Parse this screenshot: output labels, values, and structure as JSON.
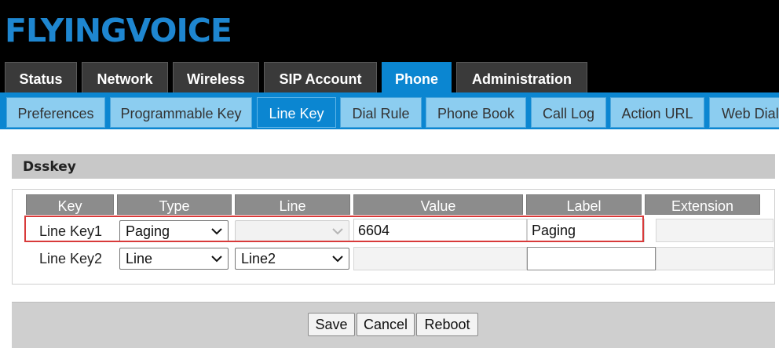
{
  "brand": {
    "logo_text": "FLYINGVOICE",
    "logo_color": "#1e86d0"
  },
  "main_tabs": [
    {
      "label": "Status"
    },
    {
      "label": "Network"
    },
    {
      "label": "Wireless"
    },
    {
      "label": "SIP Account"
    },
    {
      "label": "Phone",
      "active": true
    },
    {
      "label": "Administration"
    }
  ],
  "sub_tabs": [
    {
      "label": "Preferences"
    },
    {
      "label": "Programmable Key"
    },
    {
      "label": "Line Key",
      "active": true
    },
    {
      "label": "Dial Rule"
    },
    {
      "label": "Phone Book"
    },
    {
      "label": "Call Log"
    },
    {
      "label": "Action URL"
    },
    {
      "label": "Web Dial"
    }
  ],
  "section": {
    "title": "Dsskey"
  },
  "table": {
    "headers": [
      "Key",
      "Type",
      "Line",
      "Value",
      "Label",
      "Extension"
    ],
    "rows": [
      {
        "key": "Line Key1",
        "type": "Paging",
        "line": "",
        "line_disabled": true,
        "value": "6604",
        "label": "Paging",
        "extension": ""
      },
      {
        "key": "Line Key2",
        "type": "Line",
        "line": "Line2",
        "line_disabled": false,
        "value": "",
        "label": "",
        "extension": ""
      }
    ]
  },
  "buttons": {
    "save": "Save",
    "cancel": "Cancel",
    "reboot": "Reboot"
  },
  "colors": {
    "accent": "#0b86d1",
    "highlight": "#d83a3a",
    "header_bg": "#000000"
  }
}
